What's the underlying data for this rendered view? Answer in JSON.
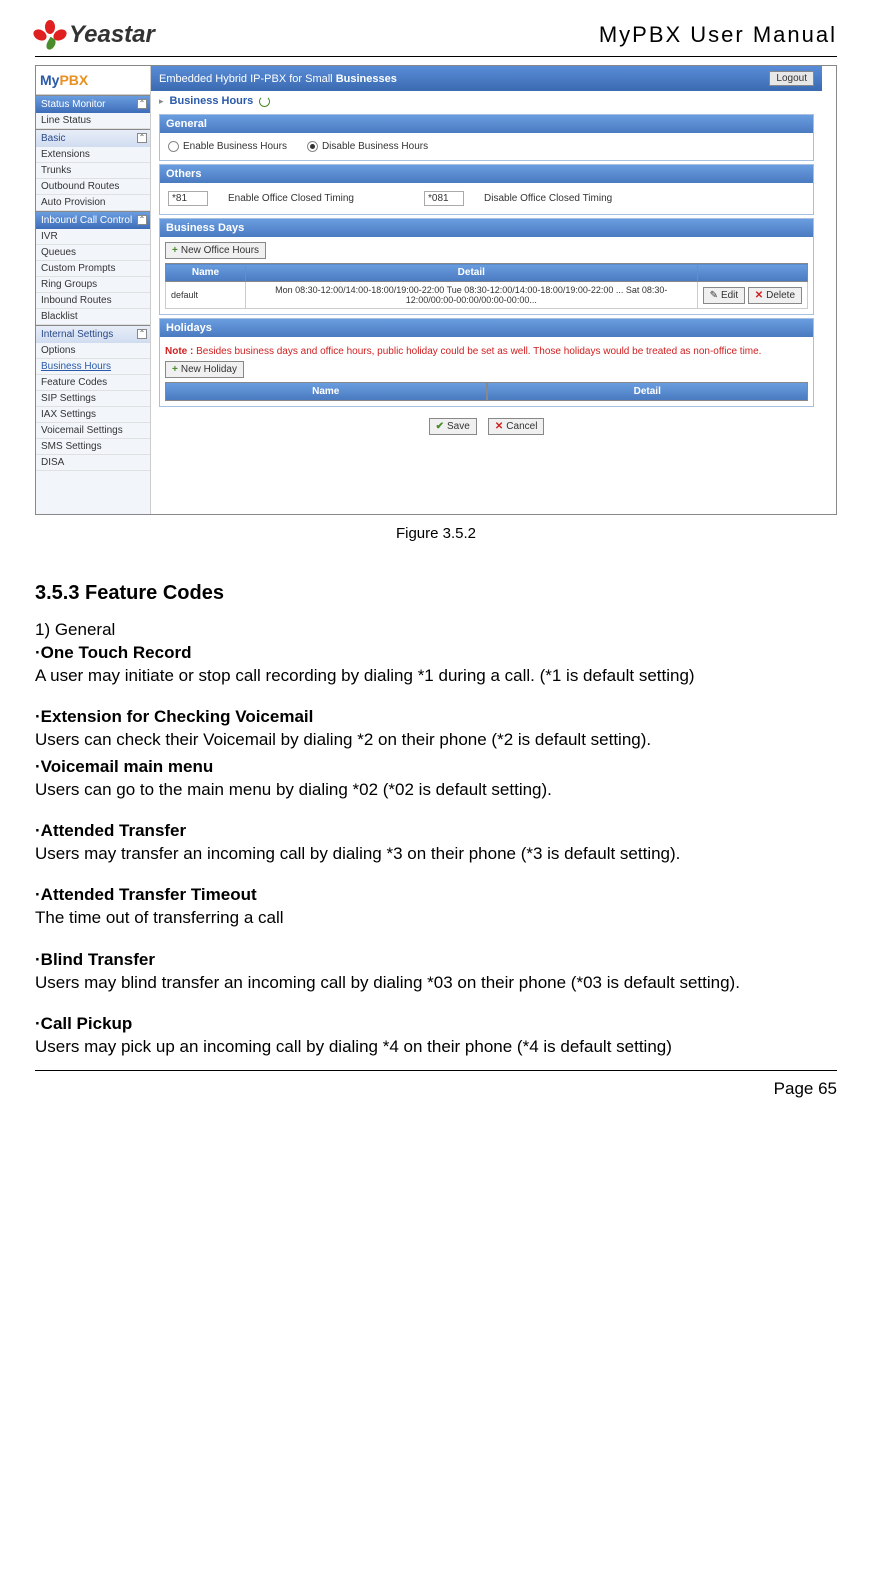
{
  "header": {
    "logo_text": "Yeastar",
    "title": "MyPBX  User  Manual"
  },
  "figure": {
    "sidebar_logo_a": "My",
    "sidebar_logo_b": "PBX",
    "topbar_text": "Embedded Hybrid IP-PBX for Small",
    "topbar_bold": "Businesses",
    "logout": "Logout",
    "groups": {
      "status": "Status Monitor",
      "line_status": "Line Status",
      "basic": "Basic",
      "basic_items": [
        "Extensions",
        "Trunks",
        "Outbound Routes",
        "Auto Provision"
      ],
      "inbound": "Inbound Call Control",
      "inbound_items": [
        "IVR",
        "Queues",
        "Custom Prompts",
        "Ring Groups",
        "Inbound Routes",
        "Blacklist"
      ],
      "internal": "Internal Settings",
      "internal_items": [
        "Options",
        "Business Hours",
        "Feature Codes",
        "SIP Settings",
        "IAX Settings",
        "Voicemail Settings",
        "SMS Settings",
        "DISA"
      ]
    },
    "crumb": "Business Hours",
    "general": {
      "title": "General",
      "enable": "Enable Business Hours",
      "disable": "Disable Business Hours"
    },
    "others": {
      "title": "Others",
      "code1": "*81",
      "label1": "Enable Office Closed Timing",
      "code2": "*081",
      "label2": "Disable Office Closed Timing"
    },
    "bdays": {
      "title": "Business Days",
      "new_btn": "New Office Hours",
      "th_name": "Name",
      "th_detail": "Detail",
      "row_name": "default",
      "row_detail": "Mon 08:30-12:00/14:00-18:00/19:00-22:00   Tue 08:30-12:00/14:00-18:00/19:00-22:00 ... Sat 08:30-12:00/00:00-00:00/00:00-00:00...",
      "edit": "Edit",
      "delete": "Delete"
    },
    "holidays": {
      "title": "Holidays",
      "note_label": "Note :",
      "note_text": "Besides business days and office hours, public holiday could be set as well. Those holidays would be treated as non-office time.",
      "new_btn": "New Holiday",
      "th_name": "Name",
      "th_detail": "Detail"
    },
    "save": "Save",
    "cancel": "Cancel",
    "caption": "Figure 3.5.2"
  },
  "body": {
    "section_title": "3.5.3 Feature Codes",
    "sub1": "1) General",
    "t1": "·One Touch Record",
    "p1": "A user may initiate or stop call recording by dialing *1 during a call. (*1 is default setting)",
    "t2": "·Extension for Checking Voicemail",
    "p2": "Users can check their Voicemail by dialing *2 on their phone (*2 is default setting).",
    "t3": "·Voicemail main menu",
    "p3": "Users can go to the main menu by dialing *02 (*02 is default setting).",
    "t4": "·Attended Transfer",
    "p4": "Users may transfer an incoming call by dialing *3 on their phone (*3 is default setting).",
    "t5": "·Attended Transfer Timeout",
    "p5": "The time out of transferring a call",
    "t6": "·Blind Transfer",
    "p6": "Users may blind transfer an incoming call by dialing *03 on their phone (*03 is default setting).",
    "t7": "·Call Pickup",
    "p7": "Users may pick up an incoming call by dialing *4 on their phone (*4 is default setting)"
  },
  "footer": {
    "page": "Page 65"
  }
}
